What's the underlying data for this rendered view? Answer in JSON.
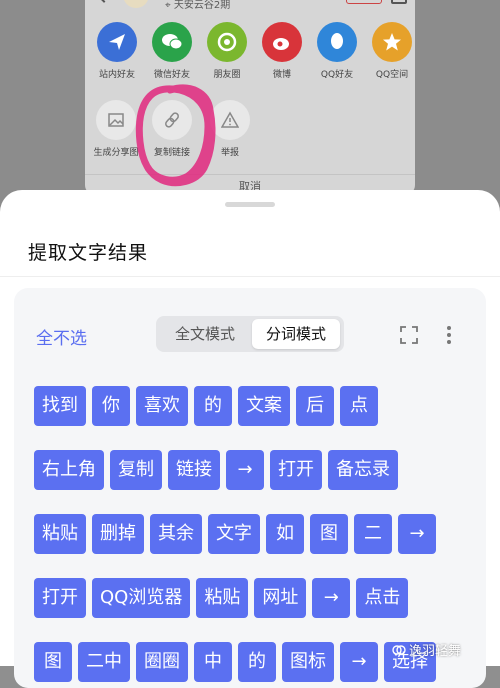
{
  "background": {
    "location": "天安云谷2期",
    "share_targets": [
      {
        "label": "站内好友",
        "icon": "paper-plane-icon",
        "color": "#3b6fd6",
        "glyph": "➤"
      },
      {
        "label": "微信好友",
        "icon": "wechat-icon",
        "color": "#2aa34a",
        "glyph": "●"
      },
      {
        "label": "朋友圈",
        "icon": "moments-icon",
        "color": "#7bb72e",
        "glyph": "◎"
      },
      {
        "label": "微博",
        "icon": "weibo-icon",
        "color": "#d8343a",
        "glyph": "◉"
      },
      {
        "label": "QQ好友",
        "icon": "qq-icon",
        "color": "#2f86d9",
        "glyph": "◕"
      },
      {
        "label": "QQ空间",
        "icon": "qzone-icon",
        "color": "#e6a12a",
        "glyph": "★"
      }
    ],
    "tools": [
      {
        "label": "生成分享图",
        "icon": "image-icon"
      },
      {
        "label": "复制链接",
        "icon": "link-icon"
      },
      {
        "label": "举报",
        "icon": "warning-icon"
      }
    ],
    "cancel": "取消"
  },
  "sheet": {
    "title": "提取文字结果",
    "deselect_all": "全不选",
    "mode_full": "全文模式",
    "mode_segment": "分词模式",
    "active_mode": "分词模式"
  },
  "chip_rows": [
    [
      "找到",
      "你",
      "喜欢",
      "的",
      "文案",
      "后",
      "点"
    ],
    [
      "右上角",
      "复制",
      "链接",
      "→",
      "打开",
      "备忘录"
    ],
    [
      "粘贴",
      "删掉",
      "其余",
      "文字",
      "如",
      "图",
      "二",
      "→"
    ],
    [
      "打开",
      "QQ浏览器",
      "粘贴",
      "网址",
      "→",
      "点击"
    ],
    [
      "图",
      "二中",
      "圈圈",
      "中",
      "的",
      "图标",
      "→",
      "选择"
    ]
  ],
  "watermark": "逸羽轻舞",
  "colors": {
    "chip": "#5b70f1",
    "accent_text": "#5a6ef0",
    "scribble": "#e0287e"
  }
}
